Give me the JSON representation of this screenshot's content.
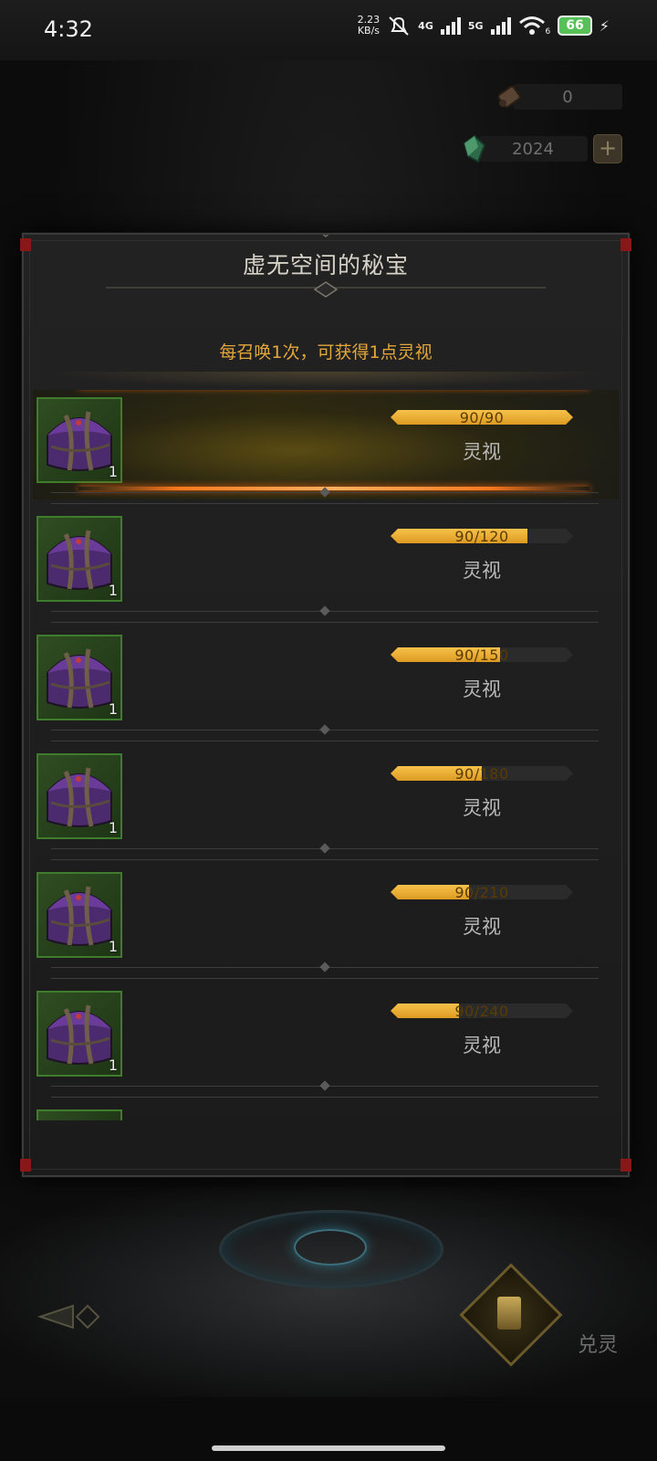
{
  "status_bar": {
    "time": "4:32",
    "net_speed_value": "2.23",
    "net_speed_unit": "KB/s",
    "cell_label_1": "4G",
    "cell_label_2": "5G",
    "wifi_sub": "6",
    "battery": "66"
  },
  "currency": {
    "scroll_amount": "0",
    "gem_amount": "2024",
    "plus_label": "+"
  },
  "modal": {
    "title": "虚无空间的秘宝",
    "subtitle": "每召唤1次，可获得1点灵视"
  },
  "rewards": [
    {
      "count": "1",
      "progress_text": "90/90",
      "progress": 1.0,
      "label": "灵视",
      "highlight": true
    },
    {
      "count": "1",
      "progress_text": "90/120",
      "progress": 0.75,
      "label": "灵视",
      "highlight": false
    },
    {
      "count": "1",
      "progress_text": "90/150",
      "progress": 0.6,
      "label": "灵视",
      "highlight": false
    },
    {
      "count": "1",
      "progress_text": "90/180",
      "progress": 0.5,
      "label": "灵视",
      "highlight": false
    },
    {
      "count": "1",
      "progress_text": "90/210",
      "progress": 0.4286,
      "label": "灵视",
      "highlight": false
    },
    {
      "count": "1",
      "progress_text": "90/240",
      "progress": 0.375,
      "label": "灵视",
      "highlight": false
    }
  ],
  "bottom": {
    "exchange_label": "兑灵"
  },
  "colors": {
    "accent_gold": "#e3a73a",
    "progress_fill": "#f0b435",
    "chest_frame": "#3f7d2c",
    "corner_red": "#8a1717"
  }
}
